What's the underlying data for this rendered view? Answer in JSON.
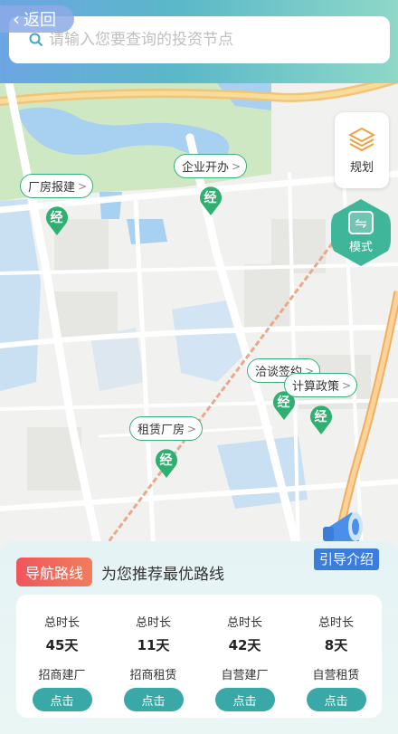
{
  "header": {
    "back_label": "返回",
    "search_placeholder": "请输入您要查询的投资节点"
  },
  "map": {
    "markers": [
      {
        "label": "厂房报建",
        "pin": "经"
      },
      {
        "label": "企业开办",
        "pin": "经"
      },
      {
        "label": "洽谈签约",
        "pin": "经"
      },
      {
        "label": "计算政策",
        "pin": "经"
      },
      {
        "label": "租赁厂房",
        "pin": "经"
      }
    ],
    "plan_label": "规划",
    "mode_label": "模式",
    "guide_label": "引导介绍"
  },
  "panel": {
    "badge": "导航路线",
    "subtitle": "为您推荐最优路线",
    "routes": [
      {
        "key": "总时长",
        "value": "45天",
        "type": "招商建厂",
        "action": "点击"
      },
      {
        "key": "总时长",
        "value": "11天",
        "type": "招商租赁",
        "action": "点击"
      },
      {
        "key": "总时长",
        "value": "42天",
        "type": "自营建厂",
        "action": "点击"
      },
      {
        "key": "总时长",
        "value": "8天",
        "type": "自营租赁",
        "action": "点击"
      }
    ]
  },
  "colors": {
    "accent": "#3aa8a6",
    "marker_green": "#34b07a",
    "badge_red": "#f0565c"
  }
}
